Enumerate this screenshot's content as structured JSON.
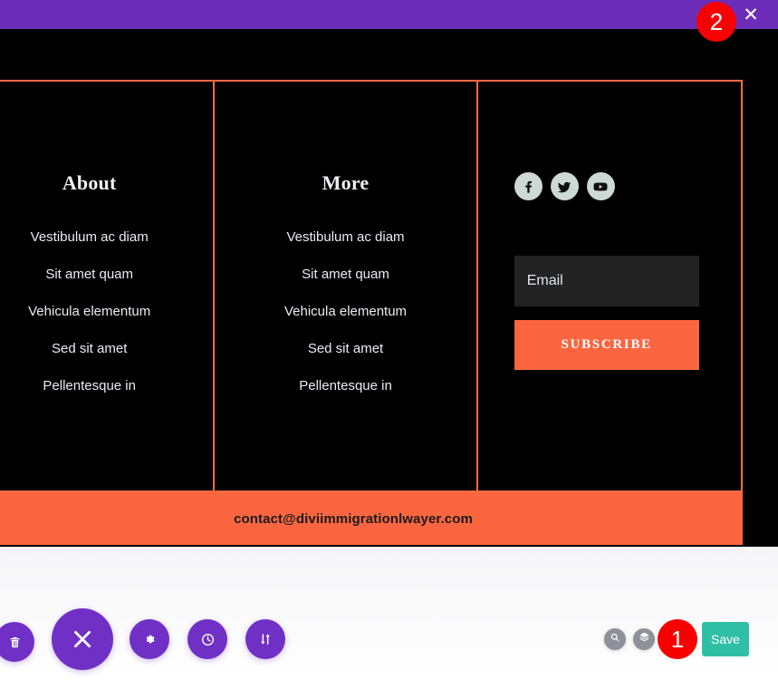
{
  "top_bar": {
    "close_label": "✕"
  },
  "badges": {
    "step_one": "1",
    "step_two": "2"
  },
  "footer": {
    "columns": [
      {
        "id": "about",
        "heading": "About",
        "links": [
          "Vestibulum ac diam",
          "Sit amet quam",
          "Vehicula elementum",
          "Sed sit amet",
          "Pellentesque in"
        ]
      },
      {
        "id": "more",
        "heading": "More",
        "links": [
          "Vestibulum ac diam",
          "Sit amet quam",
          "Vehicula elementum",
          "Sed sit amet",
          "Pellentesque in"
        ]
      }
    ],
    "social": [
      {
        "name": "facebook",
        "icon": "facebook-icon"
      },
      {
        "name": "twitter",
        "icon": "twitter-icon"
      },
      {
        "name": "youtube",
        "icon": "youtube-icon"
      }
    ],
    "signup": {
      "email_placeholder": "Email",
      "email_value": "",
      "subscribe_label": "SUBSCRIBE"
    },
    "contact_email": "contact@diviimmigrationlwayer.com"
  },
  "toolbar": {
    "trash_label": "trash-icon",
    "close_label": "close-icon",
    "settings_label": "gear-icon",
    "history_label": "clock-icon",
    "reorder_label": "sort-arrows-icon",
    "zoom_label": "magnifier-icon",
    "layers_label": "layers-icon",
    "save_label": "Save"
  },
  "colors": {
    "admin_purple": "#6c2eb9",
    "toolbar_purple": "#7030c5",
    "accent_orange": "#fb6640",
    "border_orange": "#ff6b45",
    "badge_red": "#f80000",
    "save_teal": "#2fbfa5",
    "social_circle": "#ccd9d4",
    "canvas_black": "#000000"
  }
}
